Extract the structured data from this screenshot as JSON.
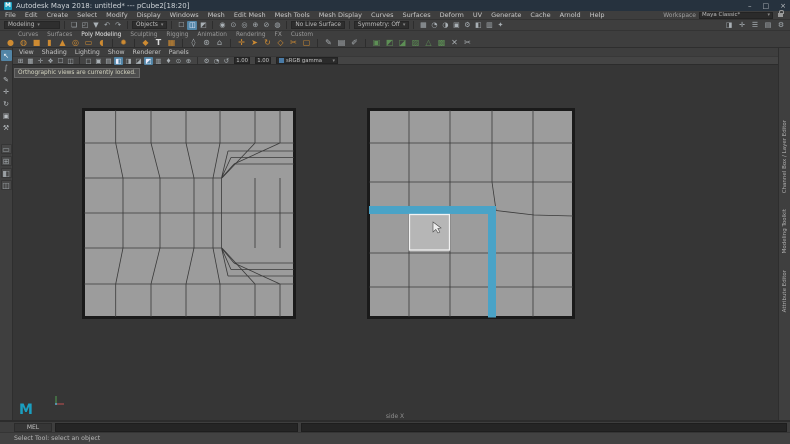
{
  "window": {
    "logo": "M",
    "title": "Autodesk Maya 2018: untitled* --- pCube2[18:20]",
    "controls": [
      "–",
      "□",
      "×"
    ]
  },
  "menubar": {
    "items": [
      "File",
      "Edit",
      "Create",
      "Select",
      "Modify",
      "Display",
      "Windows",
      "Mesh",
      "Edit Mesh",
      "Mesh Tools",
      "Mesh Display",
      "Curves",
      "Surfaces",
      "Deform",
      "UV",
      "Generate",
      "Cache",
      "Arnold",
      "Help"
    ]
  },
  "workspace": {
    "label": "Workspace",
    "value": "Maya Classic*",
    "caret": "▾"
  },
  "statusline": {
    "mode": "Modeling",
    "caret": "▾",
    "file_icons": [
      {
        "g": "❏"
      },
      {
        "g": "◰"
      },
      {
        "g": "▼"
      },
      {
        "g": "↶"
      },
      {
        "g": "↷"
      }
    ],
    "selection_mode": "Objects",
    "mask_icons": [
      {
        "g": "☐"
      },
      {
        "g": "◫",
        "c": "act"
      },
      {
        "g": "◩"
      }
    ],
    "snap_icons": [
      {
        "g": "◉"
      },
      {
        "g": "⊙"
      },
      {
        "g": "◎"
      },
      {
        "g": "⊕"
      },
      {
        "g": "⊘"
      },
      {
        "g": "◍"
      }
    ],
    "live_surface": "No Live Surface",
    "symmetry": "Symmetry: Off",
    "render_icons": [
      {
        "g": "▦"
      },
      {
        "g": "◔"
      },
      {
        "g": "◑"
      },
      {
        "g": "▣"
      },
      {
        "g": "⚙"
      },
      {
        "g": "◧"
      },
      {
        "g": "▥"
      },
      {
        "g": "✦"
      }
    ],
    "sidebar_toggles": [
      {
        "g": "◨"
      },
      {
        "g": "✛"
      },
      {
        "g": "☰"
      },
      {
        "g": "▤"
      },
      {
        "g": "⚙"
      }
    ]
  },
  "shelf": {
    "tabs": [
      {
        "label": "Curves"
      },
      {
        "label": "Surfaces"
      },
      {
        "label": "Poly Modeling",
        "cls": "act"
      },
      {
        "label": "Sculpting"
      },
      {
        "label": "Rigging"
      },
      {
        "label": "Animation"
      },
      {
        "label": "Rendering"
      },
      {
        "label": "FX"
      },
      {
        "label": "Custom"
      }
    ],
    "icons": [
      {
        "g": "●",
        "c": "org"
      },
      {
        "g": "◍",
        "c": "org"
      },
      {
        "g": "■",
        "c": "org"
      },
      {
        "g": "▮",
        "c": "org"
      },
      {
        "g": "▲",
        "c": "org"
      },
      {
        "g": "◎",
        "c": "org"
      },
      {
        "g": "▭",
        "c": "org"
      },
      {
        "g": "◖",
        "c": "org"
      },
      {
        "c": "sep"
      },
      {
        "g": "✹",
        "c": "org"
      },
      {
        "c": "sep"
      },
      {
        "g": "◆",
        "c": "org"
      },
      {
        "g": "T",
        "c": "wht"
      },
      {
        "g": "▦",
        "c": "org"
      },
      {
        "c": "sep"
      },
      {
        "g": "◊",
        "c": "gry"
      },
      {
        "g": "⊛",
        "c": "gry"
      },
      {
        "g": "⌂",
        "c": "gry"
      },
      {
        "c": "sep"
      },
      {
        "g": "✛",
        "c": "org"
      },
      {
        "g": "➤",
        "c": "org"
      },
      {
        "g": "↻",
        "c": "org"
      },
      {
        "g": "◇",
        "c": "org"
      },
      {
        "g": "✂",
        "c": "org"
      },
      {
        "g": "▢",
        "c": "org"
      },
      {
        "c": "sep"
      },
      {
        "g": "✎",
        "c": "gry"
      },
      {
        "g": "▤",
        "c": "gry"
      },
      {
        "g": "✐",
        "c": "gry"
      },
      {
        "c": "sep"
      },
      {
        "g": "▣",
        "c": "grn"
      },
      {
        "g": "◩",
        "c": "grn"
      },
      {
        "g": "◪",
        "c": "grn"
      },
      {
        "g": "▨",
        "c": "grn"
      },
      {
        "g": "△",
        "c": "grn"
      },
      {
        "g": "▩",
        "c": "grn"
      },
      {
        "g": "✕",
        "c": "gry"
      },
      {
        "g": "✂",
        "c": "gry"
      }
    ]
  },
  "panel_menu": {
    "items": [
      "View",
      "Shading",
      "Lighting",
      "Show",
      "Renderer",
      "Panels"
    ]
  },
  "viewport_bar": {
    "icons": [
      {
        "g": "⊞"
      },
      {
        "g": "▦"
      },
      {
        "g": "✛"
      },
      {
        "g": "❖"
      },
      {
        "g": "☐"
      },
      {
        "g": "◫"
      },
      {
        "c": "sep"
      },
      {
        "g": "□"
      },
      {
        "g": "▣"
      },
      {
        "g": "▤"
      },
      {
        "g": "◧",
        "c": "act"
      },
      {
        "g": "◨"
      },
      {
        "g": "◪"
      },
      {
        "g": "◩",
        "c": "act"
      },
      {
        "g": "▥"
      },
      {
        "g": "♦"
      },
      {
        "g": "⊙"
      },
      {
        "g": "⊕"
      },
      {
        "c": "sep"
      },
      {
        "g": "⚙"
      },
      {
        "g": "◔"
      },
      {
        "g": "↺"
      }
    ],
    "exposure": "1.00",
    "gamma": "1.00",
    "view_transform": "sRGB gamma",
    "caret": "▾"
  },
  "viewport": {
    "tooltip": "Orthographic views are currently locked.",
    "camera_label": "side X"
  },
  "right_sidebar": {
    "tabs": [
      "Channel Box / Layer Editor",
      "Modeling Toolkit",
      "Attribute Editor"
    ]
  },
  "tools": {
    "items": [
      {
        "g": "↖",
        "c": "act"
      },
      {
        "g": "∫"
      },
      {
        "g": "✎"
      },
      {
        "g": "✛"
      },
      {
        "g": "↻"
      },
      {
        "g": "▣"
      },
      {
        "g": "⚒"
      }
    ],
    "layouts": [
      {
        "g": "▭"
      },
      {
        "g": "⊞"
      },
      {
        "g": "◧"
      },
      {
        "g": "◫"
      }
    ]
  },
  "command_line": {
    "label": "MEL"
  },
  "help_line": {
    "text": "Select Tool: select an object"
  },
  "colors": {
    "selection_blue": "#4aa3c7",
    "mesh_gray": "#9c9c9c",
    "shelf_orange": "#ce8b32",
    "shelf_green": "#5d8f55",
    "maya_teal": "#1b9fc0",
    "titlebar": "#26323e"
  }
}
